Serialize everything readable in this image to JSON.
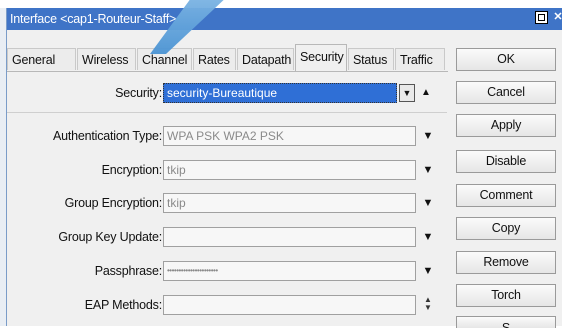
{
  "window": {
    "title": "Interface <cap1-Routeur-Staff>"
  },
  "tabs": [
    {
      "label": "General"
    },
    {
      "label": "Wireless"
    },
    {
      "label": "Channel"
    },
    {
      "label": "Rates"
    },
    {
      "label": "Datapath"
    },
    {
      "label": "Security",
      "active": true
    },
    {
      "label": "Status"
    },
    {
      "label": "Traffic"
    }
  ],
  "form": {
    "security": {
      "label": "Security:",
      "value": "security-Bureautique"
    },
    "auth_type": {
      "label": "Authentication Type:",
      "value": "WPA PSK WPA2 PSK"
    },
    "encryption": {
      "label": "Encryption:",
      "value": "tkip"
    },
    "group_encryption": {
      "label": "Group Encryption:",
      "value": "tkip"
    },
    "group_key_update": {
      "label": "Group Key Update:",
      "value": ""
    },
    "passphrase": {
      "label": "Passphrase:",
      "value": "••••••••••••••••••••••"
    },
    "eap_methods": {
      "label": "EAP Methods:",
      "value": ""
    }
  },
  "buttons": {
    "ok": "OK",
    "cancel": "Cancel",
    "apply": "Apply",
    "disable": "Disable",
    "comment": "Comment",
    "copy": "Copy",
    "remove": "Remove",
    "torch": "Torch",
    "next": "S"
  },
  "colors": {
    "titlebar": "#3f74c7",
    "selected": "#2f6fd6",
    "window_bg": "#f0f0f0"
  }
}
